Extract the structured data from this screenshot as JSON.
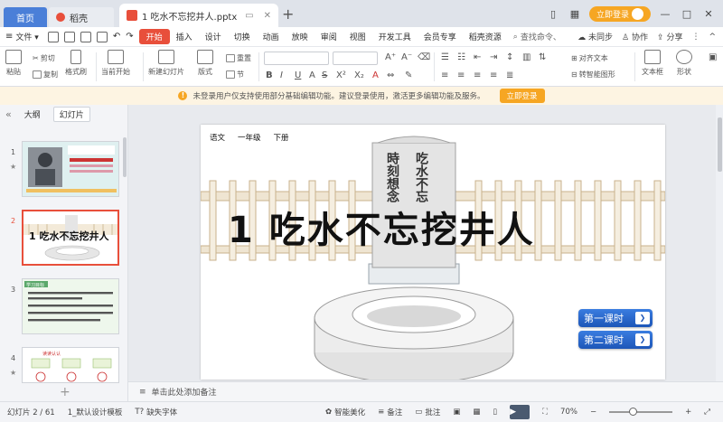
{
  "titlebar": {
    "home_tab": "首页",
    "daoke_tab": "稻壳",
    "file_tab": "1 吃水不忘挖井人.pptx",
    "new_tab": "+",
    "login": "立即登录",
    "win_min": "—",
    "win_max": "□",
    "win_close": "✕"
  },
  "menu": {
    "file": "文件",
    "file_arrow": "▾",
    "items": [
      "开始",
      "插入",
      "设计",
      "切换",
      "动画",
      "放映",
      "审阅",
      "视图",
      "开发工具",
      "会员专享",
      "稻壳资源"
    ],
    "search": "查找命令、",
    "sync": "未同步",
    "collab": "协作",
    "share": "分享",
    "more": "⋮",
    "collapse": "^"
  },
  "ribbon": {
    "paste": "粘贴",
    "cut": "剪切",
    "copy": "复制",
    "format_painter": "格式刷",
    "from_current": "当前开始",
    "new_slide": "新建幻灯片",
    "layout": "版式",
    "section": "节",
    "reset": "重置",
    "bold": "B",
    "italic": "I",
    "underline": "U",
    "strike": "S",
    "font_a": "A",
    "align_text": "对齐文本",
    "smart_shape": "转智能图形",
    "textbox": "文本框",
    "shape": "形状"
  },
  "notice": {
    "text": "未登录用户仅支持使用部分基础编辑功能。建议登录使用，激活更多编辑功能及服务。",
    "button": "立即登录"
  },
  "leftpanel": {
    "outline": "大纲",
    "slides": "幻灯片",
    "collapse": "«",
    "add": "+",
    "numbers": [
      "1",
      "2",
      "3",
      "4"
    ],
    "thumb3_title": "学习目标",
    "thumb4_title": "读读认认"
  },
  "slide": {
    "subject": "语文",
    "grade": "一年级",
    "term": "下册",
    "title": "1  吃水不忘挖井人",
    "lesson1": "第一课时",
    "lesson2": "第二课时",
    "arrow": "❯",
    "monument_left": "時刻想念",
    "monument_right": "吃水不忘"
  },
  "notes": {
    "text": "单击此处添加备注"
  },
  "status": {
    "slide_count": "幻灯片 2 / 61",
    "template": "1_默认设计模板",
    "missing_font": "缺失字体",
    "beautify": "智能美化",
    "notes": "备注",
    "comments": "批注",
    "zoom": "70%",
    "zoom_minus": "−",
    "zoom_plus": "+"
  }
}
